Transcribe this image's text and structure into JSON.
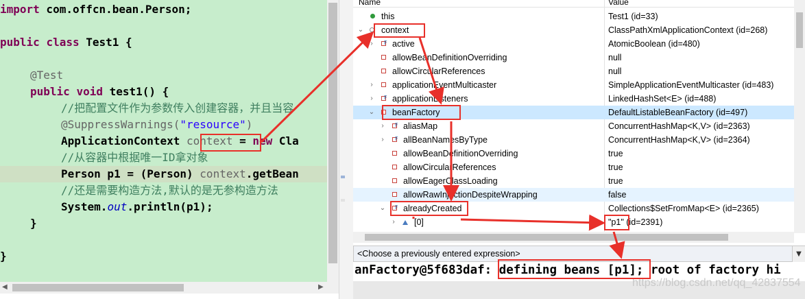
{
  "editor": {
    "lines": {
      "l1": {
        "kw": "import",
        "rest": " com.offcn.bean.Person;"
      },
      "l2": {
        "kw1": "public",
        "kw2": "class",
        "rest": " Test1 {"
      },
      "l3": {
        "ann": "@Test"
      },
      "l4": {
        "kw1": "public",
        "kw2": "void",
        "rest": " test1() {"
      },
      "l5": {
        "cmt": "//把配置文件作为参数传入创建容器，并且当容"
      },
      "l6": {
        "ann": "@SuppressWarnings(",
        "str": "\"resource\"",
        "rest": ")"
      },
      "l7": {
        "pre": "ApplicationContext ",
        "var": "context",
        "mid": " = ",
        "kw": "new",
        "rest": " Cla"
      },
      "l8": {
        "cmt": "//从容器中根据唯一ID拿对象"
      },
      "l9": {
        "pre": "Person p1 = (Person) ",
        "var": "context",
        "rest": ".getBean"
      },
      "l10": {
        "cmt": "//还是需要构造方法,默认的是无参构造方法"
      },
      "l11": {
        "pre": "System.",
        "fld": "out",
        "rest": ".println(p1);"
      },
      "l12": {
        "text": "}"
      },
      "l13": {
        "text": "}"
      }
    }
  },
  "vars": {
    "header": {
      "name": "Name",
      "value": "Value"
    },
    "rows": [
      {
        "name": "this",
        "value": "Test1  (id=33)"
      },
      {
        "name": "context",
        "value": "ClassPathXmlApplicationContext  (id=268)"
      },
      {
        "name": "active",
        "value": "AtomicBoolean  (id=480)"
      },
      {
        "name": "allowBeanDefinitionOverriding",
        "value": "null"
      },
      {
        "name": "allowCircularReferences",
        "value": "null"
      },
      {
        "name": "applicationEventMulticaster",
        "value": "SimpleApplicationEventMulticaster  (id=483)"
      },
      {
        "name": "applicationListeners",
        "value": "LinkedHashSet<E>  (id=488)"
      },
      {
        "name": "beanFactory",
        "value": "DefaultListableBeanFactory  (id=497)"
      },
      {
        "name": "aliasMap",
        "value": "ConcurrentHashMap<K,V>  (id=2363)"
      },
      {
        "name": "allBeanNamesByType",
        "value": "ConcurrentHashMap<K,V>  (id=2364)"
      },
      {
        "name": "allowBeanDefinitionOverriding",
        "value": "true"
      },
      {
        "name": "allowCircularReferences",
        "value": "true"
      },
      {
        "name": "allowEagerClassLoading",
        "value": "true"
      },
      {
        "name": "allowRawInjectionDespiteWrapping",
        "value": "false"
      },
      {
        "name": "alreadyCreated",
        "value": "Collections$SetFromMap<E>  (id=2365)"
      },
      {
        "name": "[0]",
        "value": "\"p1\"  (id=2391)"
      }
    ]
  },
  "expression": {
    "placeholder": "<Choose a previously entered expression>"
  },
  "console": {
    "text": "anFactory@5f683daf: defining beans [p1]; root of factory hi"
  },
  "watermark": "https://blog.csdn.net/qq_42837554",
  "colors": {
    "editor_bg": "#c7edcc",
    "annotation": "#e8302a",
    "selection": "#cce8ff"
  }
}
